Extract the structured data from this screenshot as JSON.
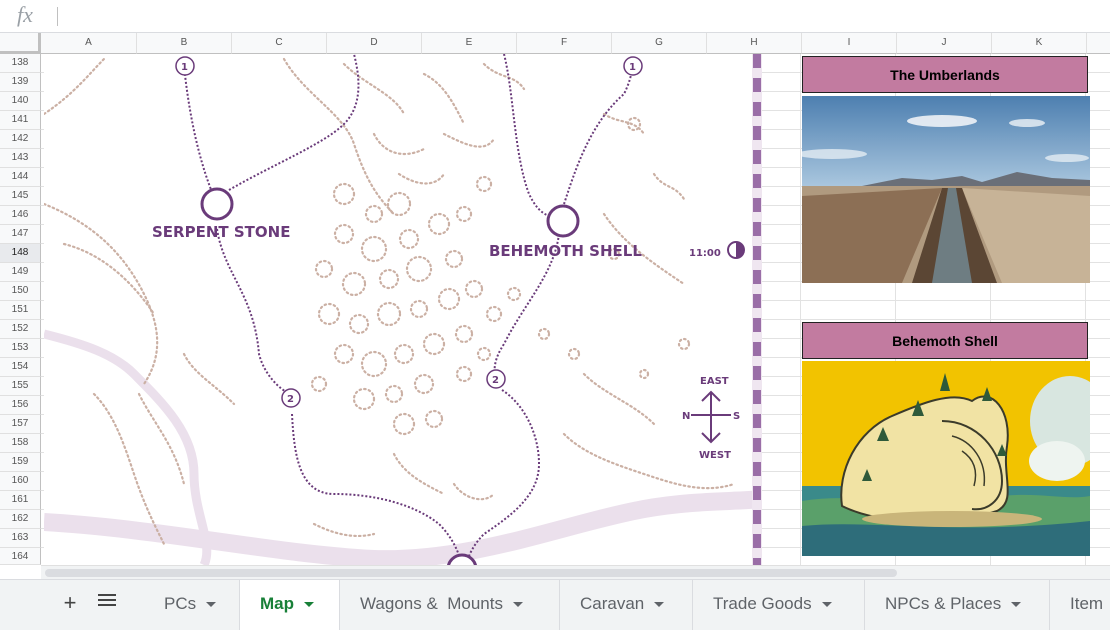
{
  "formula_bar": {
    "label": "fx",
    "value": ""
  },
  "columns": [
    "A",
    "B",
    "C",
    "D",
    "E",
    "F",
    "G",
    "H",
    "I",
    "J",
    "K"
  ],
  "rows": [
    "138",
    "139",
    "140",
    "141",
    "142",
    "143",
    "144",
    "145",
    "146",
    "147",
    "148",
    "149",
    "150",
    "151",
    "152",
    "153",
    "154",
    "155",
    "156",
    "157",
    "158",
    "159",
    "160",
    "161",
    "162",
    "163",
    "164"
  ],
  "selected_row": "148",
  "map": {
    "places": {
      "serpent_stone": "SERPENT STONE",
      "behemoth_shell": "BEHEMOTH SHELL"
    },
    "waypoints": {
      "w1a": "1",
      "w1b": "1",
      "w2a": "2",
      "w2b": "2"
    },
    "time": "11:00",
    "compass": {
      "east": "EAST",
      "west": "WEST",
      "north": "N",
      "south": "S"
    }
  },
  "panels": {
    "umberlands": "The Umberlands",
    "behemoth": "Behemoth Shell"
  },
  "tabs": [
    {
      "label": "PCs"
    },
    {
      "label": "Map"
    },
    {
      "label": "Wagons &  Mounts"
    },
    {
      "label": "Caravan"
    },
    {
      "label": "Trade Goods"
    },
    {
      "label": "NPCs & Places"
    },
    {
      "label": "Item"
    }
  ],
  "active_tab": "Map",
  "icons": {
    "add": "plus-icon",
    "all_sheets": "list-icon"
  },
  "colors": {
    "route": "#6a3b7a",
    "header_fill": "#c27ba0",
    "active_tab": "#188038",
    "dunes": "#c9a99a",
    "river": "#e8dcea"
  }
}
